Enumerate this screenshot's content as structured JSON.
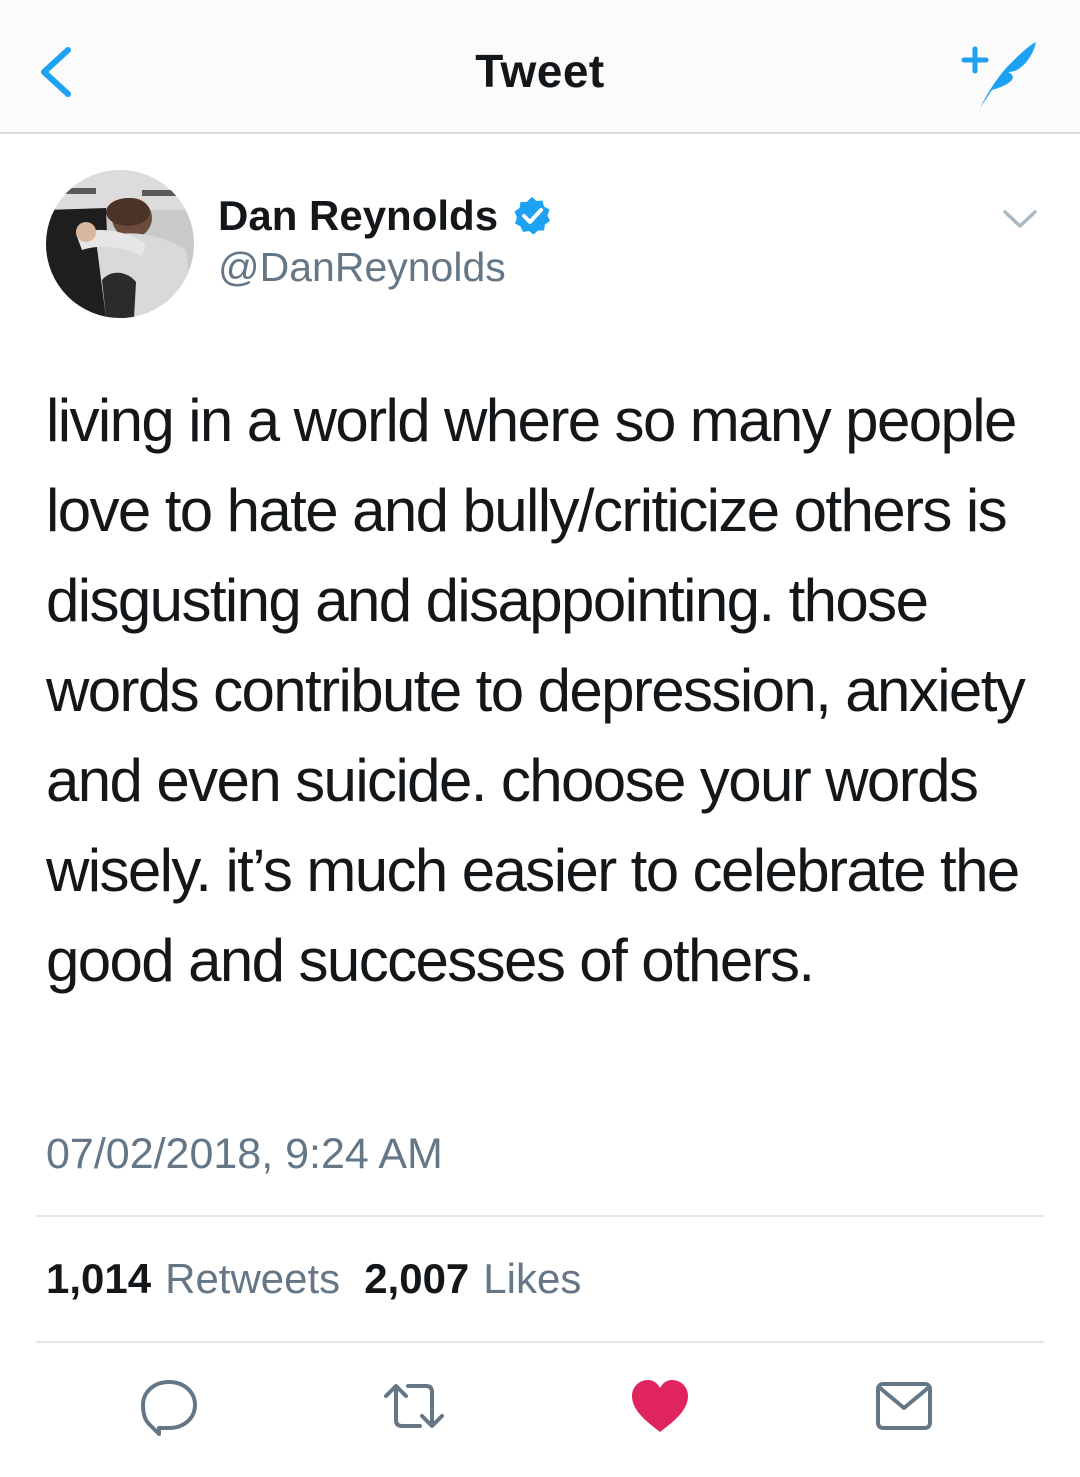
{
  "nav": {
    "title": "Tweet",
    "back_icon": "chevron-left-icon",
    "compose_icon": "compose-tweet-icon"
  },
  "author": {
    "display_name": "Dan Reynolds",
    "handle": "@DanReynolds",
    "verified": true,
    "avatar": "profile-photo"
  },
  "tweet": {
    "text": "living in a world where so many people love to hate and bully/criticize others is disgusting and disappointing. those words contribute to depression, anxiety and even suicide. choose your words wisely. it’s much easier to celebrate the good and successes of others.",
    "timestamp": "07/02/2018, 9:24 AM"
  },
  "stats": {
    "retweets_count": "1,014",
    "retweets_label": "Retweets",
    "likes_count": "2,007",
    "likes_label": "Likes"
  },
  "actions": [
    {
      "icon": "reply-icon"
    },
    {
      "icon": "retweet-icon"
    },
    {
      "icon": "heart-icon",
      "active": true
    },
    {
      "icon": "message-icon"
    }
  ],
  "colors": {
    "accent": "#1da1f2",
    "like_active": "#e0245e",
    "secondary_text": "#657786",
    "icon_gray": "#657786"
  }
}
